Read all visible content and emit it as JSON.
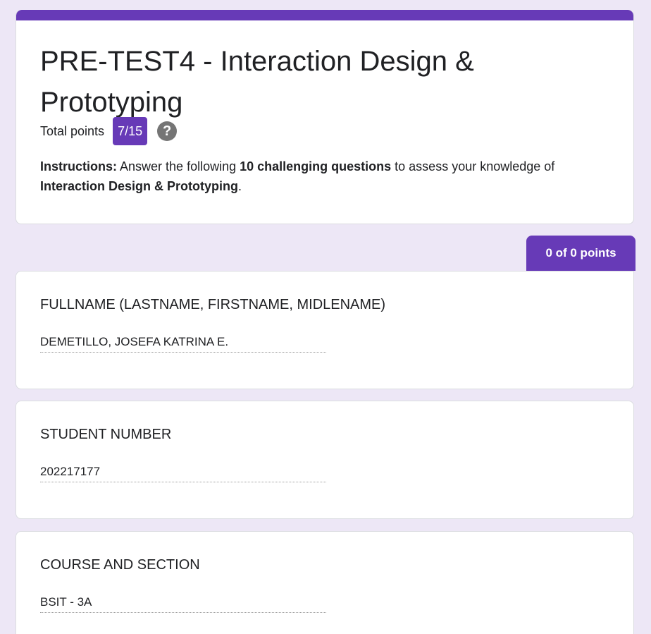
{
  "form": {
    "title": "PRE-TEST4 - Interaction Design & Prototyping",
    "total_points_label": "Total points",
    "score": "7/15",
    "help_glyph": "?",
    "instructions": {
      "lead": "Instructions:",
      "text1": " Answer the following ",
      "bold1": "10 challenging questions",
      "text2": " to assess your knowledge of ",
      "bold2": "Interaction Design & Prototyping",
      "text3": "."
    },
    "accent_color": "#673ab7"
  },
  "section": {
    "points_label": "0 of 0 points"
  },
  "questions": [
    {
      "title": "FULLNAME (LASTNAME, FIRSTNAME, MIDLENAME)",
      "answer": "DEMETILLO, JOSEFA KATRINA E."
    },
    {
      "title": "STUDENT NUMBER",
      "answer": "202217177"
    },
    {
      "title": "COURSE AND SECTION",
      "answer": "BSIT - 3A"
    }
  ]
}
